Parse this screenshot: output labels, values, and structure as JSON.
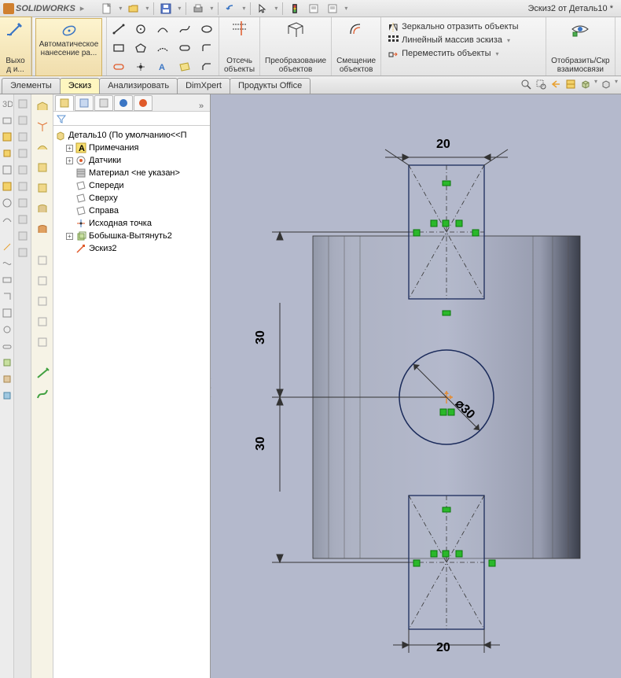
{
  "app_name": "SOLIDWORKS",
  "doc_title": "Эскиз2 от Деталь10 *",
  "ribbon": {
    "exit": "Выхо\nд и...",
    "autodim": "Автоматическое\nнанесение ра...",
    "trim": "Отсечь\nобъекты",
    "convert": "Преобразование\nобъектов",
    "offset": "Смещение\nобъектов",
    "mirror": "Зеркально отразить объекты",
    "linear": "Линейный массив эскиза",
    "move": "Переместить объекты",
    "display": "Отобразить/Скр\nвзаимосвязи"
  },
  "tabs": [
    "Элементы",
    "Эскиз",
    "Анализировать",
    "DimXpert",
    "Продукты Office"
  ],
  "active_tab": 1,
  "tree": {
    "root": "Деталь10  (По умолчанию<<П",
    "items": [
      {
        "icon": "A",
        "label": "Примечания",
        "toggle": "+"
      },
      {
        "icon": "sensor",
        "label": "Датчики",
        "toggle": "+"
      },
      {
        "icon": "mat",
        "label": "Материал <не указан>"
      },
      {
        "icon": "plane",
        "label": "Спереди"
      },
      {
        "icon": "plane",
        "label": "Сверху"
      },
      {
        "icon": "plane",
        "label": "Справа"
      },
      {
        "icon": "origin",
        "label": "Исходная точка"
      },
      {
        "icon": "extrude",
        "label": "Бобышка-Вытянуть2",
        "toggle": "+"
      },
      {
        "icon": "sketch",
        "label": "Эскиз2"
      }
    ]
  },
  "dims": {
    "top_width": "20",
    "bottom_width": "20",
    "upper_30": "30",
    "lower_30": "30",
    "dia": "⌀30"
  },
  "chart_data": {
    "type": "sketch",
    "description": "Top-view sketch on extruded rectangular boss. Two 20-wide rectangles (top & bottom, with crossed constructions), circle Ø30 at center, upper and lower rects vertically offset 30 each from center.",
    "circle": {
      "diameter": 30,
      "center": "boss center"
    },
    "rect_width": 20,
    "offsets_from_center": [
      30,
      30
    ]
  }
}
